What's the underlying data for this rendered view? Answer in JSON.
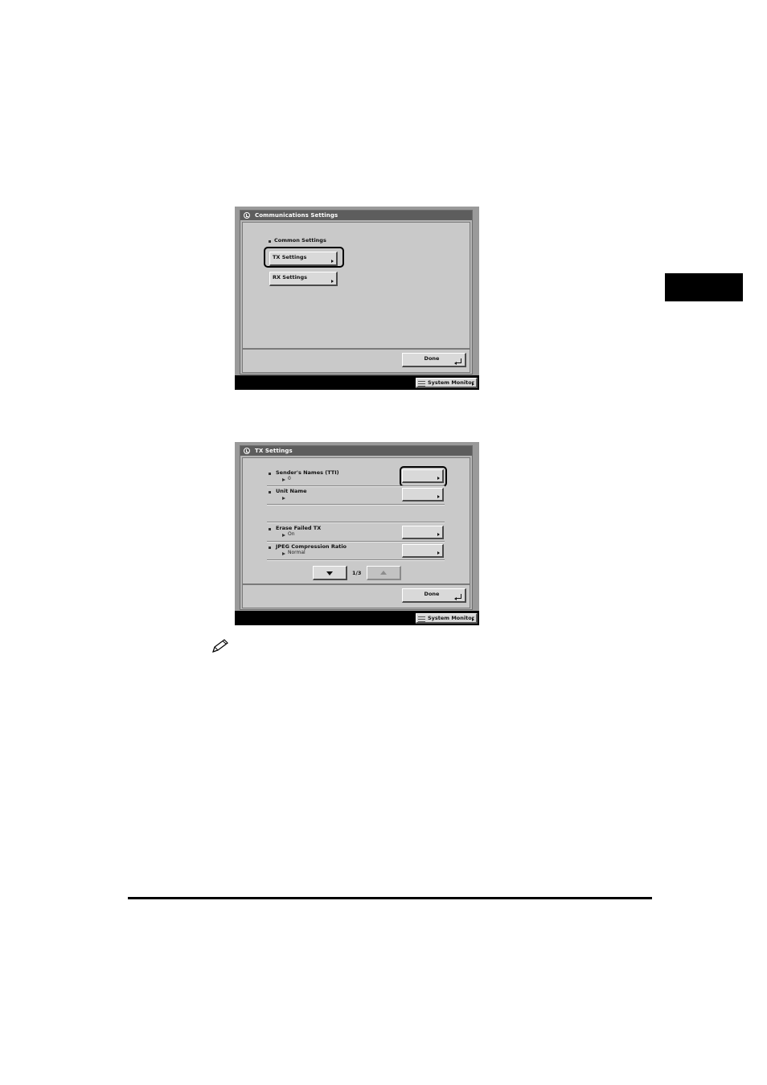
{
  "screen1": {
    "title": "Communications Settings",
    "section_label": "Common Settings",
    "tx_button": "TX Settings",
    "rx_button": "RX Settings",
    "done_button": "Done",
    "system_monitor": "System Monitor"
  },
  "screen2": {
    "title": "TX Settings",
    "rows": [
      {
        "label": "Sender's Names (TTI)",
        "value": "0"
      },
      {
        "label": "Unit Name",
        "value": ""
      },
      {
        "label": "Erase Failed TX",
        "value": "On"
      },
      {
        "label": "JPEG Compression Ratio",
        "value": "Normal"
      }
    ],
    "page_indicator": "1/3",
    "done_button": "Done",
    "system_monitor": "System Monitor"
  },
  "icons": [
    "machine-settings-icon",
    "pencil-note-icon",
    "arrow-right-icon",
    "enter-icon",
    "down-arrow-icon",
    "up-arrow-icon"
  ]
}
